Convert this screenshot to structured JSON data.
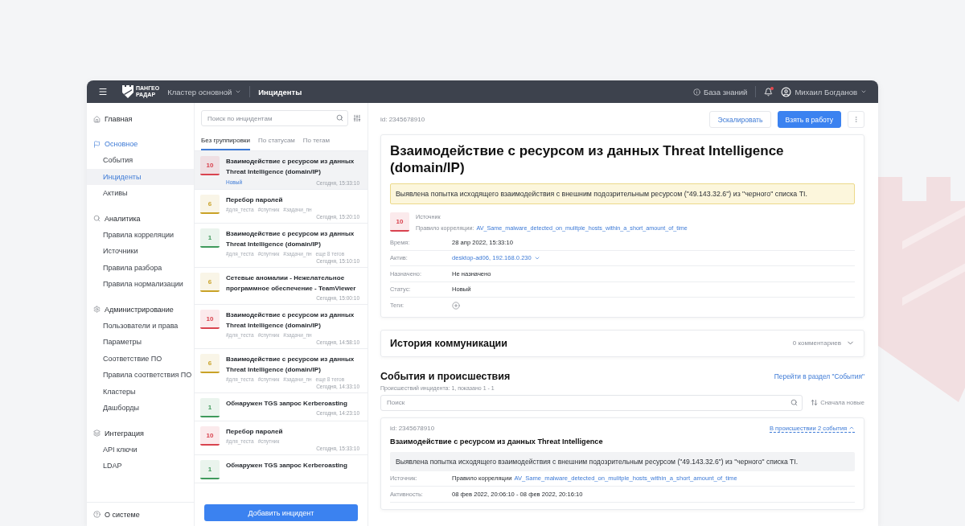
{
  "header": {
    "logo": [
      "ПАНГЕО",
      "РАДАР"
    ],
    "cluster": "Кластер основной",
    "title": "Инциденты",
    "knowledge_base": "База знаний",
    "notifications": {
      "unread": true
    },
    "user": "Михаил Богданов"
  },
  "sidebar": {
    "sections": [
      {
        "label": "Главная",
        "selected": false
      },
      {
        "label": "Основное",
        "selected": true,
        "children": [
          {
            "label": "События",
            "selected": false
          },
          {
            "label": "Инциденты",
            "selected": true
          },
          {
            "label": "Активы",
            "selected": false
          }
        ]
      },
      {
        "label": "Аналитика",
        "selected": false,
        "children": [
          {
            "label": "Правила корреляции",
            "selected": false
          },
          {
            "label": "Источники",
            "selected": false
          },
          {
            "label": "Правила разбора",
            "selected": false
          },
          {
            "label": "Правила нормализации",
            "selected": false
          }
        ]
      },
      {
        "label": "Администрирование",
        "selected": false,
        "children": [
          {
            "label": "Пользователи и права",
            "selected": false
          },
          {
            "label": "Параметры",
            "selected": false
          },
          {
            "label": "Соответствие ПО",
            "selected": false
          },
          {
            "label": "Правила соответствия ПО",
            "selected": false
          },
          {
            "label": "Кластеры",
            "selected": false
          },
          {
            "label": "Дашборды",
            "selected": false
          }
        ]
      },
      {
        "label": "Интеграция",
        "selected": false,
        "children": [
          {
            "label": "API ключи",
            "selected": false
          },
          {
            "label": "LDAP",
            "selected": false
          }
        ]
      }
    ],
    "footer": "О системе"
  },
  "incidents": {
    "search": {
      "placeholder": "Поиск по инцидентам"
    },
    "tabs": [
      {
        "label": "Без группировки",
        "selected": true
      },
      {
        "label": "По статусам",
        "selected": false
      },
      {
        "label": "По тегам",
        "selected": false
      }
    ],
    "items": [
      {
        "severity": "10",
        "color": "#d9434f",
        "title": "Взаимодействие с ресурсом из данных Threat Intelligence (domain/IP)",
        "status": "Новый",
        "time": "Сегодня, 15:33:10",
        "selected": true
      },
      {
        "severity": "6",
        "color": "#c9a227",
        "title": "Перебор паролей",
        "tags": [
          "#для_теста",
          "#спутник",
          "#задачи_пн"
        ],
        "time": "Сегодня, 15:20:10",
        "selected": false
      },
      {
        "severity": "1",
        "color": "#3f9a5c",
        "title": "Взаимодействие с ресурсом из данных Threat Intelligence (domain/IP)",
        "tags": [
          "#для_теста",
          "#спутник",
          "#задачи_пн",
          "еще 8 тегов"
        ],
        "time": "Сегодня, 15:10:10",
        "selected": false
      },
      {
        "severity": "6",
        "color": "#c9a227",
        "title": "Сетевые аномалии - Нежелательное программное обеспечение - TeamViewer",
        "time": "Сегодня, 15:00:10",
        "selected": false
      },
      {
        "severity": "10",
        "color": "#d9434f",
        "title": "Взаимодействие с ресурсом из данных Threat Intelligence (domain/IP)",
        "tags": [
          "#для_теста",
          "#спутник",
          "#задачи_пн"
        ],
        "time": "Сегодня, 14:58:10",
        "selected": false
      },
      {
        "severity": "6",
        "color": "#c9a227",
        "title": "Взаимодействие с ресурсом из данных Threat Intelligence (domain/IP)",
        "tags": [
          "#для_теста",
          "#спутник",
          "#задачи_пн",
          "еще 8 тегов"
        ],
        "time": "Сегодня, 14:33:10",
        "selected": false
      },
      {
        "severity": "1",
        "color": "#3f9a5c",
        "title": "Обнаружен TGS запрос Kerberoasting",
        "time": "Сегодня, 14:23:10",
        "selected": false
      },
      {
        "severity": "10",
        "color": "#d9434f",
        "title": "Перебор паролей",
        "tags": [
          "#для_теста",
          "#спутник"
        ],
        "time": "Сегодня, 15:33:10",
        "selected": false
      },
      {
        "severity": "1",
        "color": "#3f9a5c",
        "title": "Обнаружен TGS запрос Kerberoasting",
        "selected": false
      }
    ],
    "add_button": "Добавить инцидент"
  },
  "detail": {
    "id": "id: 2345678910",
    "buttons": [
      {
        "label": "Эскалировать",
        "kind": "secondary"
      },
      {
        "label": "Взять в работу",
        "kind": "primary"
      }
    ],
    "title": "Взаимодействие с ресурсом из данных Threat Intelligence (domain/IP)",
    "alert": "Выявлена попытка исходящего взаимодействия с внешним подозрительным ресурсом (\"49.143.32.6\") из \"черного\" списка TI.",
    "source": {
      "severity": "10",
      "color": "#d9434f",
      "label": "Источник",
      "rule_label": "Правило корреляции:",
      "rule": "AV_Same_malware_detected_on_mulitple_hosts_within_a_short_amount_of_time"
    },
    "fields": [
      {
        "label": "Время:",
        "kind": "text",
        "value": "28 апр 2022, 15:33:10"
      },
      {
        "label": "Актив:",
        "kind": "asset",
        "value": "desktop-ad06, 192.168.0.230"
      },
      {
        "label": "Назначено:",
        "kind": "text",
        "value": "Не назначено"
      },
      {
        "label": "Статус:",
        "kind": "text",
        "value": "Новый"
      },
      {
        "label": "Теги:",
        "kind": "add"
      }
    ]
  },
  "history": {
    "title": "История коммуникации",
    "count": "0 комментариев",
    "expanded": false
  },
  "events": {
    "title": "События и происшествия",
    "link": "Перейти в раздел \"События\"",
    "summary": "Происшествий инцидента: 1, показано 1 - 1",
    "search": {
      "placeholder": "Поиск"
    },
    "sort": "Сначала новые",
    "cards": [
      {
        "id": "id: 2345678910",
        "toggle": "В происшествии 2 события",
        "expanded": true,
        "title": "Взаимодействие с ресурсом из данных Threat Intelligence",
        "message": "Выявлена попытка исходящего взаимодействия с внешним подозрительным ресурсом (\"49.143.32.6\") из \"черного\" списка TI.",
        "fields": [
          {
            "label": "Источник:",
            "prefix": "Правило корреляции",
            "link": "AV_Same_malware_detected_on_mulitple_hosts_within_a_short_amount_of_time"
          },
          {
            "label": "Активность:",
            "value": "08 фев 2022, 20:06:10 - 08 фев 2022, 20:16:10"
          }
        ]
      }
    ]
  }
}
